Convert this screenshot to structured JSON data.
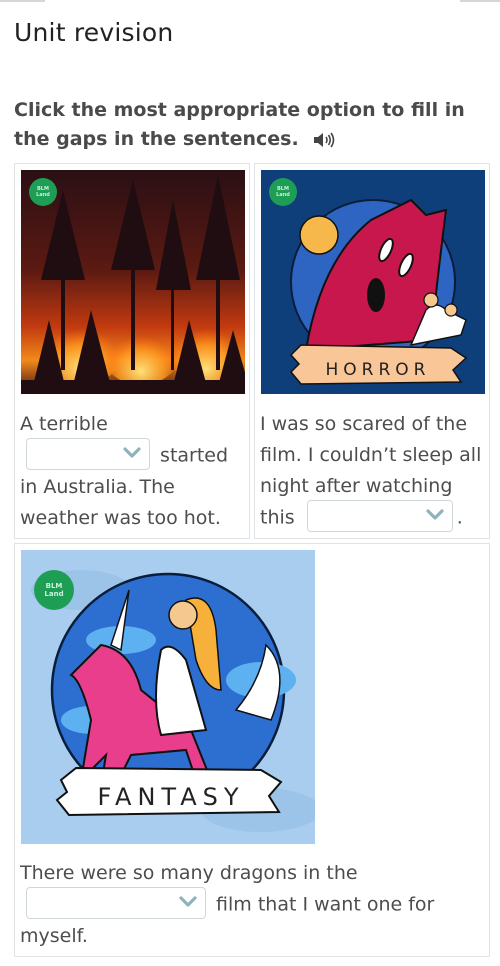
{
  "page": {
    "title": "Unit revision",
    "instruction": "Click the most appropriate option to fill in the gaps in the sentences.",
    "audio_icon": "speaker-icon"
  },
  "badge": {
    "line1": "BLM",
    "line2": "Land"
  },
  "cards": [
    {
      "image": "forest-fire",
      "before": "A terrible",
      "gap_value": "",
      "after": "started in Australia. The weather was too hot."
    },
    {
      "image": "horror",
      "image_caption": "HORROR",
      "before": "I was so scared of the film. I couldn’t sleep all night after watching this",
      "gap_value": "",
      "after": "."
    },
    {
      "image": "fantasy",
      "image_caption": "FANTASY",
      "before": "There were so many dragons in the",
      "gap_value": "",
      "after": "film that I want one for myself."
    }
  ],
  "colors": {
    "chevron": "#8fb3bb",
    "card_border": "#dde3e6",
    "badge": "#1e9e55",
    "horror_bg": "#0f3f7a",
    "fantasy_bg": "#a9cdee"
  }
}
